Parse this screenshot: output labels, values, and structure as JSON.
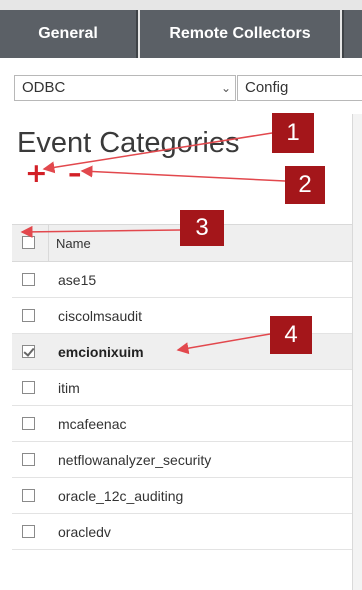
{
  "tabs": [
    {
      "label": "General"
    },
    {
      "label": "Remote Collectors"
    }
  ],
  "filters": {
    "type_select": {
      "value": "ODBC"
    },
    "config_select": {
      "value": "Config"
    }
  },
  "panel": {
    "title": "Event Categories",
    "add_icon": "plus-icon",
    "remove_icon": "minus-icon"
  },
  "table": {
    "columns": [
      "Name"
    ],
    "rows": [
      {
        "name": "ase15",
        "checked": false
      },
      {
        "name": "ciscolmsaudit",
        "checked": false
      },
      {
        "name": "emcionixuim",
        "checked": true
      },
      {
        "name": "itim",
        "checked": false
      },
      {
        "name": "mcafeenac",
        "checked": false
      },
      {
        "name": "netflowanalyzer_security",
        "checked": false
      },
      {
        "name": "oracle_12c_auditing",
        "checked": false
      },
      {
        "name": "oracledv",
        "checked": false
      }
    ]
  },
  "callouts": [
    {
      "number": "1"
    },
    {
      "number": "2"
    },
    {
      "number": "3"
    },
    {
      "number": "4"
    }
  ],
  "colors": {
    "tab_bg": "#5b6066",
    "accent_red": "#d21f26",
    "callout_bg": "#a4161a"
  }
}
